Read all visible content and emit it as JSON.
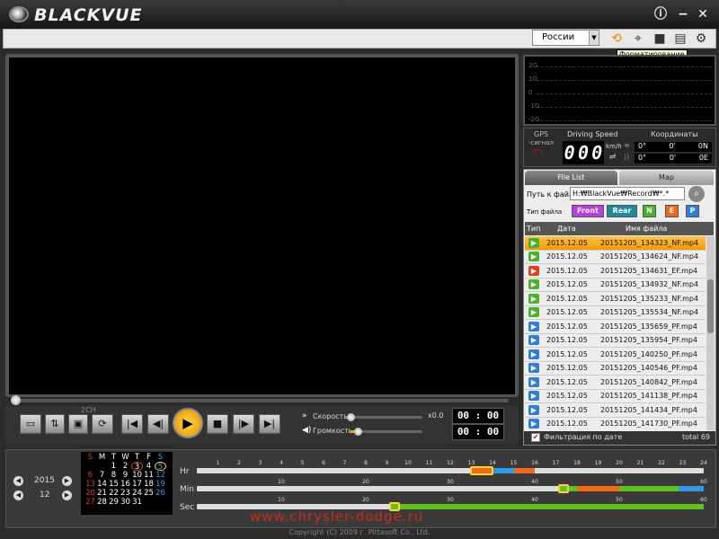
{
  "app": {
    "title": "BLACKVUE"
  },
  "titlebar": {
    "info_icon": "ⓘ",
    "minimize_icon": "−",
    "close_icon": "✕"
  },
  "toolbar": {
    "language": "России",
    "format_tooltip": "Форматирование"
  },
  "gsensor": {
    "labels": [
      "2G",
      "1G",
      "0",
      "-1G",
      "-2G"
    ]
  },
  "gps": {
    "gps_label": "GPS",
    "signal_label": "-сигнал",
    "speed_title": "Driving Speed",
    "speed_digits": [
      "0",
      "0",
      "0"
    ],
    "speed_unit": "km/h",
    "coords_title": "Координаты",
    "lat": {
      "deg": "0°",
      "min": "0'",
      "dir": "0N"
    },
    "lon": {
      "deg": "0°",
      "min": "0'",
      "dir": "0E"
    }
  },
  "tabs": {
    "file_list": "File List",
    "map": "Map"
  },
  "path": {
    "label": "Путь к файлу",
    "value": "H:₩BlackVue₩Record₩*.*"
  },
  "file_type": {
    "label": "Тип файла",
    "front": "Front",
    "rear": "Rear",
    "n": "N",
    "e": "E",
    "p": "P"
  },
  "list_header": {
    "type": "Тип",
    "date": "Дата",
    "name": "Имя файла"
  },
  "files": [
    {
      "kind": "N",
      "date": "2015.12.05",
      "name": "20151205_134323_NF.mp4",
      "selected": true
    },
    {
      "kind": "N",
      "date": "2015.12.05",
      "name": "20151205_134624_NF.mp4"
    },
    {
      "kind": "E",
      "date": "2015.12.05",
      "name": "20151205_134631_EF.mp4"
    },
    {
      "kind": "N",
      "date": "2015.12.05",
      "name": "20151205_134932_NF.mp4"
    },
    {
      "kind": "N",
      "date": "2015.12.05",
      "name": "20151205_135233_NF.mp4"
    },
    {
      "kind": "N",
      "date": "2015.12.05",
      "name": "20151205_135534_NF.mp4"
    },
    {
      "kind": "P",
      "date": "2015.12.05",
      "name": "20151205_135659_PF.mp4"
    },
    {
      "kind": "P",
      "date": "2015.12.05",
      "name": "20151205_135954_PF.mp4"
    },
    {
      "kind": "P",
      "date": "2015.12.05",
      "name": "20151205_140250_PF.mp4"
    },
    {
      "kind": "P",
      "date": "2015.12.05",
      "name": "20151205_140546_PF.mp4"
    },
    {
      "kind": "P",
      "date": "2015.12.05",
      "name": "20151205_140842_PF.mp4"
    },
    {
      "kind": "P",
      "date": "2015.12.05",
      "name": "20151205_141138_PF.mp4"
    },
    {
      "kind": "P",
      "date": "2015.12.05",
      "name": "20151205_141434_PF.mp4"
    },
    {
      "kind": "P",
      "date": "2015.12.05",
      "name": "20151205_141730_PF.mp4"
    }
  ],
  "filter": {
    "label": "Фильтрация по дате",
    "total": "total 69",
    "checked": true
  },
  "player": {
    "ch_label": "2CH",
    "speed_label": "Скорость",
    "speed_value": "x0.0",
    "volume_label": "Громкость",
    "time_current": "00 : 00",
    "time_total": "00 : 00",
    "seek_progress": 0,
    "speed_level": 0,
    "volume_level": 0.1
  },
  "calendar": {
    "year": "2015",
    "month": "12",
    "weekdays": [
      "S",
      "M",
      "T",
      "W",
      "T",
      "F",
      "S"
    ],
    "lead_blanks": 2,
    "days": 31,
    "recorded_day": 3,
    "selected_day": 5
  },
  "timeline": {
    "hr_label": "Hr",
    "min_label": "Min",
    "sec_label": "Sec",
    "hr_ticks": [
      "1",
      "2",
      "3",
      "4",
      "5",
      "6",
      "7",
      "8",
      "9",
      "10",
      "11",
      "12",
      "13",
      "14",
      "15",
      "16",
      "17",
      "18",
      "19",
      "20",
      "21",
      "22",
      "23",
      "24"
    ],
    "min_ticks": [
      "10",
      "20",
      "30",
      "40",
      "50",
      "60"
    ],
    "sec_ticks": [
      "10",
      "20",
      "30",
      "40",
      "50",
      "60"
    ],
    "selected_hour": 13,
    "selected_minute": 43,
    "selected_second": 23,
    "colors": {
      "normal": "#2f9be8",
      "event": "#f06a1a",
      "parking": "#2f9be8",
      "green": "#5fc21e",
      "selected": "#ffd23a"
    }
  },
  "watermark": "www.chrysler-dodge.ru",
  "copyright": "Copyright (C) 2009 г. Pittasoft Co., Ltd."
}
